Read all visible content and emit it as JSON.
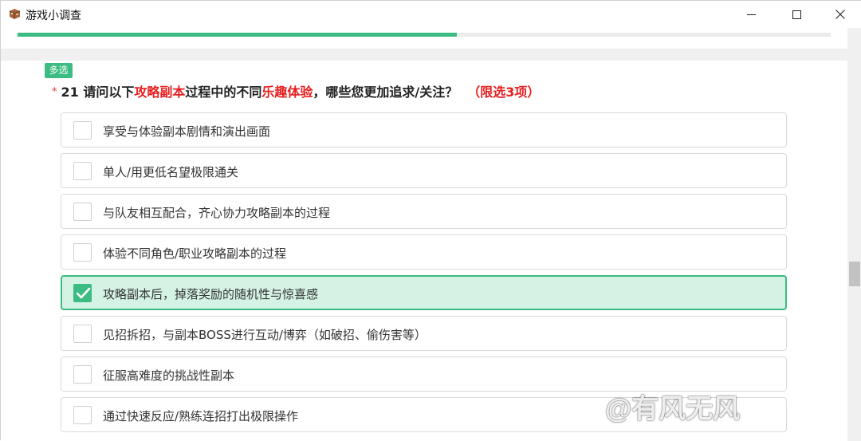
{
  "window": {
    "title": "游戏小调查",
    "icons": {
      "app": "game-controller-icon",
      "minimize": "minimize-icon",
      "maximize": "maximize-icon",
      "close": "close-icon"
    }
  },
  "progress": {
    "fraction": 0.54
  },
  "question": {
    "tag": "多选",
    "required_mark": "*",
    "number": "21",
    "text_part1": "请问以下",
    "highlight1": "攻略副本",
    "text_part2": "过程中的不同",
    "highlight2": "乐趣体验",
    "text_part3": "，哪些您更加追求/关注？",
    "limit": "（限选3项）",
    "highlight_color": "#e61f1f"
  },
  "options": [
    {
      "label": "享受与体验副本剧情和演出画面",
      "selected": false
    },
    {
      "label": "单人/用更低名望极限通关",
      "selected": false
    },
    {
      "label": "与队友相互配合，齐心协力攻略副本的过程",
      "selected": false
    },
    {
      "label": "体验不同角色/职业攻略副本的过程",
      "selected": false
    },
    {
      "label": "攻略副本后，掉落奖励的随机性与惊喜感",
      "selected": true
    },
    {
      "label": "见招拆招，与副本BOSS进行互动/博弈（如破招、偷伤害等）",
      "selected": false
    },
    {
      "label": "征服高难度的挑战性副本",
      "selected": false
    },
    {
      "label": "通过快速反应/熟练连招打出极限操作",
      "selected": false
    }
  ],
  "accent_color": "#3cbc82",
  "watermark": "@有风无风"
}
